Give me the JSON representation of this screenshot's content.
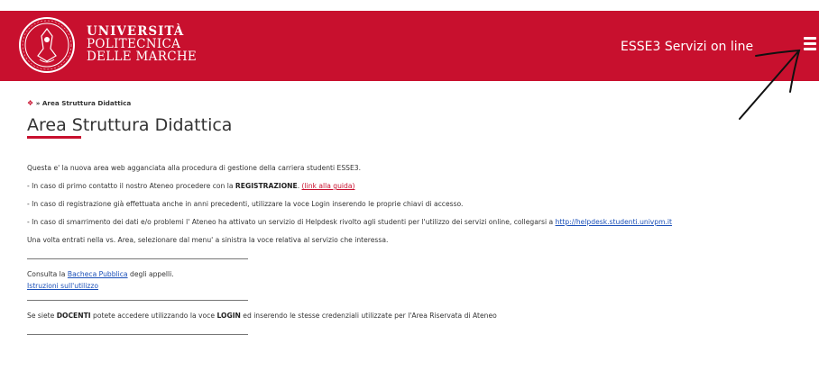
{
  "header": {
    "university_lines": [
      "UNIVERSITÀ",
      "POLITECNICA",
      "DELLE MARCHE"
    ],
    "app_title": "ESSE3 Servizi on line",
    "brand_color": "#c8102e",
    "menu_icon": "hamburger-menu-icon"
  },
  "breadcrumb": {
    "home_icon": "home-icon",
    "separator": "»",
    "current": "Area Struttura Didattica"
  },
  "page_title": "Area Struttura Didattica",
  "intro": {
    "line1": "Questa e' la nuova area web agganciata alla procedura di gestione della carriera studenti ESSE3.",
    "line2_prefix": "- In caso di primo contatto il nostro Ateneo procedere con la ",
    "line2_bold": "REGISTRAZIONE",
    "line2_sep": ". ",
    "line2_link": "(link alla guida)",
    "line3": "- In caso di registrazione già effettuata anche in anni precedenti, utilizzare la voce Login inserendo le proprie chiavi di accesso.",
    "line4_prefix": "- In caso di smarrimento dei dati e/o problemi l' Ateneo ha attivato un servizio di Helpdesk rivolto agli studenti per l'utilizzo dei servizi online, collegarsi a ",
    "line4_link": "http://helpdesk.studenti.univpm.it",
    "line5": "Una volta entrati nella vs. Area, selezionare dal menu' a sinistra la voce relativa al servizio che interessa."
  },
  "bacheca": {
    "prefix": "Consulta la ",
    "link": "Bacheca Pubblica",
    "suffix": " degli appelli.",
    "istruzioni_link": "Istruzioni sull'utilizzo"
  },
  "docenti": {
    "prefix": "Se siete ",
    "bold1": "DOCENTI",
    "middle": " potete accedere utilizzando la voce ",
    "bold2": "LOGIN",
    "suffix": " ed inserendo le stesse credenziali utilizzate per l'Area Riservata di Ateneo"
  }
}
